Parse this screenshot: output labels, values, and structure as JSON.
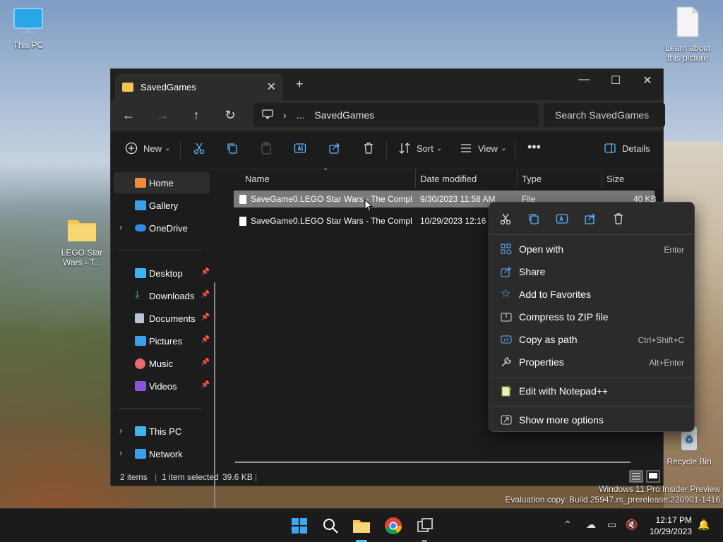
{
  "desktop": {
    "icons": [
      {
        "label": "This PC"
      },
      {
        "label": "LEGO Star Wars - T..."
      },
      {
        "label": "Learn about this picture"
      },
      {
        "label": "Recycle Bin"
      }
    ]
  },
  "window": {
    "tab_title": "SavedGames",
    "address_segments": [
      "...",
      "SavedGames"
    ],
    "search_placeholder": "Search SavedGames",
    "toolbar": {
      "new_label": "New",
      "sort_label": "Sort",
      "view_label": "View",
      "details_label": "Details"
    },
    "nav": {
      "home": "Home",
      "gallery": "Gallery",
      "onedrive": "OneDrive",
      "desktop": "Desktop",
      "downloads": "Downloads",
      "documents": "Documents",
      "pictures": "Pictures",
      "music": "Music",
      "videos": "Videos",
      "thispc": "This PC",
      "network": "Network"
    },
    "columns": {
      "name": "Name",
      "date": "Date modified",
      "type": "Type",
      "size": "Size"
    },
    "files": [
      {
        "name": "SaveGame0.LEGO Star Wars - The Compl...",
        "date": "9/30/2023 11:58 AM",
        "type": "File",
        "size": "40 KB"
      },
      {
        "name": "SaveGame0.LEGO Star Wars - The Compl...",
        "date": "10/29/2023 12:16 P",
        "type": "",
        "size": ""
      }
    ],
    "status": {
      "count": "2 items",
      "selected": "1 item selected",
      "size": "39.6 KB"
    }
  },
  "context_menu": {
    "items": [
      {
        "label": "Open with",
        "shortcut": "Enter"
      },
      {
        "label": "Share",
        "shortcut": ""
      },
      {
        "label": "Add to Favorites",
        "shortcut": ""
      },
      {
        "label": "Compress to ZIP file",
        "shortcut": ""
      },
      {
        "label": "Copy as path",
        "shortcut": "Ctrl+Shift+C"
      },
      {
        "label": "Properties",
        "shortcut": "Alt+Enter"
      },
      {
        "label": "Edit with Notepad++",
        "shortcut": ""
      },
      {
        "label": "Show more options",
        "shortcut": ""
      }
    ]
  },
  "watermark": {
    "line1": "Windows 11 Pro Insider Preview",
    "line2": "Evaluation copy. Build 25947.rs_prerelease.230901-1416"
  },
  "taskbar": {
    "time": "12:17 PM",
    "date": "10/29/2023"
  },
  "colors": {
    "accent": "#4cc2ff",
    "folder": "#f3c54e",
    "window_bg": "#1c1c1c",
    "taskbar_bg": "#1b1b1b"
  }
}
